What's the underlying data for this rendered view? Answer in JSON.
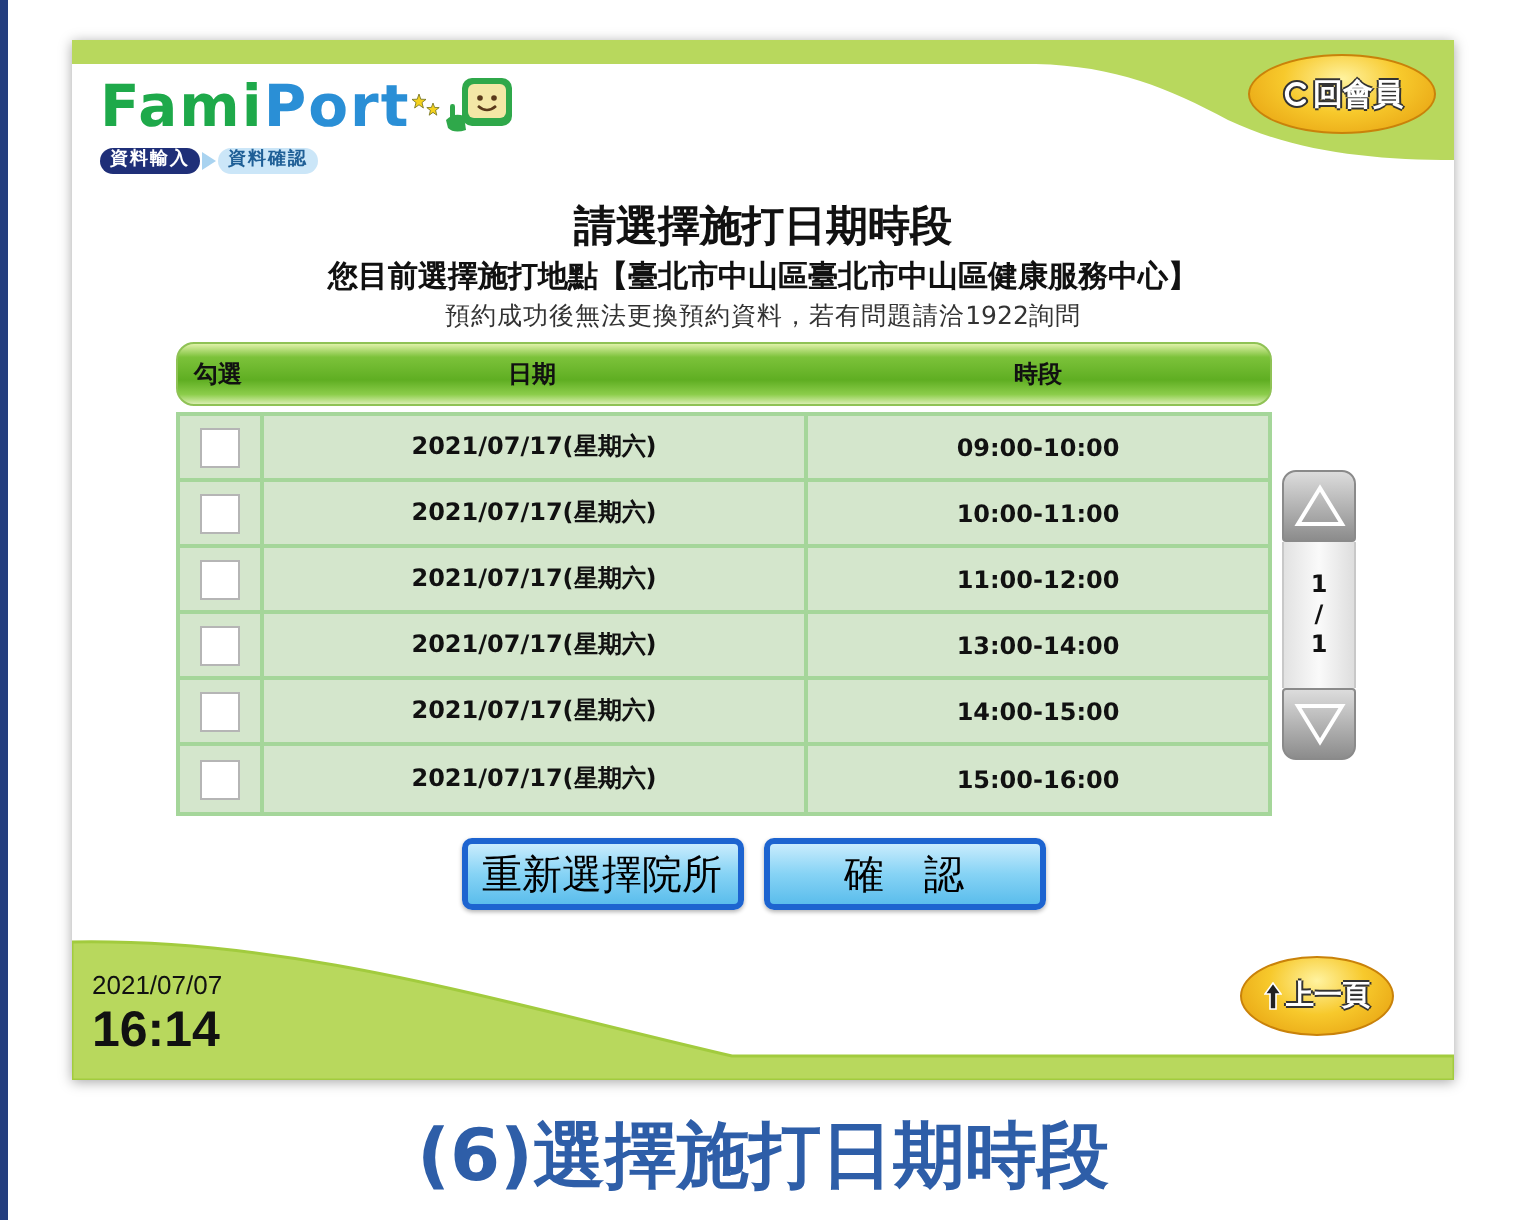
{
  "header": {
    "logo": [
      "Fami",
      "Port"
    ],
    "steps": [
      {
        "label": "資料輸入",
        "selected": true
      },
      {
        "label": "資料確認",
        "selected": false
      }
    ],
    "member_button": "回會員"
  },
  "intro": {
    "title": "請選擇施打日期時段",
    "location": "您目前選擇施打地點【臺北市中山區臺北市中山區健康服務中心】",
    "notice": "預約成功後無法更換預約資料，若有問題請洽1922詢問"
  },
  "table": {
    "columns": [
      "勾選",
      "日期",
      "時段"
    ],
    "rows": [
      {
        "checked": false,
        "date": "2021/07/17(星期六)",
        "time": "09:00-10:00"
      },
      {
        "checked": false,
        "date": "2021/07/17(星期六)",
        "time": "10:00-11:00"
      },
      {
        "checked": false,
        "date": "2021/07/17(星期六)",
        "time": "11:00-12:00"
      },
      {
        "checked": false,
        "date": "2021/07/17(星期六)",
        "time": "13:00-14:00"
      },
      {
        "checked": false,
        "date": "2021/07/17(星期六)",
        "time": "14:00-15:00"
      },
      {
        "checked": false,
        "date": "2021/07/17(星期六)",
        "time": "15:00-16:00"
      }
    ]
  },
  "pager": {
    "current": "1",
    "separator": "/",
    "total": "1"
  },
  "buttons": [
    "重新選擇院所",
    "確　認"
  ],
  "footer": {
    "date": "2021/07/07",
    "time": "16:14",
    "back_button": "上一頁"
  },
  "caption": "(6)選擇施打日期時段"
}
